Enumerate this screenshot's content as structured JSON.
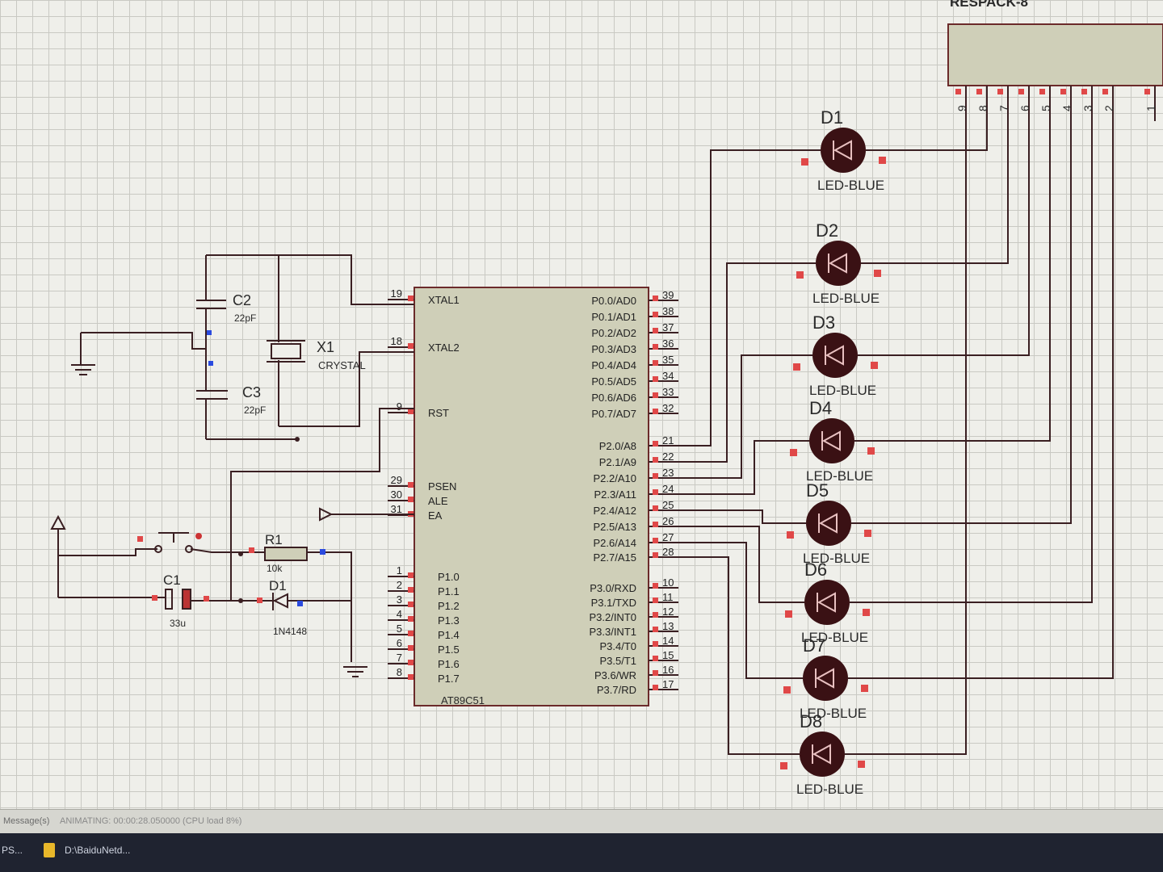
{
  "chip": {
    "name": "AT89C51",
    "left_pins": [
      {
        "num": "19",
        "name": "XTAL1"
      },
      {
        "num": "18",
        "name": "XTAL2"
      },
      {
        "num": "9",
        "name": "RST"
      },
      {
        "num": "29",
        "name": "PSEN"
      },
      {
        "num": "30",
        "name": "ALE"
      },
      {
        "num": "31",
        "name": "EA"
      },
      {
        "num": "1",
        "name": "P1.0"
      },
      {
        "num": "2",
        "name": "P1.1"
      },
      {
        "num": "3",
        "name": "P1.2"
      },
      {
        "num": "4",
        "name": "P1.3"
      },
      {
        "num": "5",
        "name": "P1.4"
      },
      {
        "num": "6",
        "name": "P1.5"
      },
      {
        "num": "7",
        "name": "P1.6"
      },
      {
        "num": "8",
        "name": "P1.7"
      }
    ],
    "right_pins": [
      {
        "num": "39",
        "name": "P0.0/AD0"
      },
      {
        "num": "38",
        "name": "P0.1/AD1"
      },
      {
        "num": "37",
        "name": "P0.2/AD2"
      },
      {
        "num": "36",
        "name": "P0.3/AD3"
      },
      {
        "num": "35",
        "name": "P0.4/AD4"
      },
      {
        "num": "34",
        "name": "P0.5/AD5"
      },
      {
        "num": "33",
        "name": "P0.6/AD6"
      },
      {
        "num": "32",
        "name": "P0.7/AD7"
      },
      {
        "num": "21",
        "name": "P2.0/A8"
      },
      {
        "num": "22",
        "name": "P2.1/A9"
      },
      {
        "num": "23",
        "name": "P2.2/A10"
      },
      {
        "num": "24",
        "name": "P2.3/A11"
      },
      {
        "num": "25",
        "name": "P2.4/A12"
      },
      {
        "num": "26",
        "name": "P2.5/A13"
      },
      {
        "num": "27",
        "name": "P2.6/A14"
      },
      {
        "num": "28",
        "name": "P2.7/A15"
      },
      {
        "num": "10",
        "name": "P3.0/RXD"
      },
      {
        "num": "11",
        "name": "P3.1/TXD"
      },
      {
        "num": "12",
        "name": "P3.2/INT0"
      },
      {
        "num": "13",
        "name": "P3.3/INT1"
      },
      {
        "num": "14",
        "name": "P3.4/T0"
      },
      {
        "num": "15",
        "name": "P3.5/T1"
      },
      {
        "num": "16",
        "name": "P3.6/WR"
      },
      {
        "num": "17",
        "name": "P3.7/RD"
      }
    ]
  },
  "components": {
    "c2": {
      "ref": "C2",
      "value": "22pF"
    },
    "c3": {
      "ref": "C3",
      "value": "22pF"
    },
    "x1": {
      "ref": "X1",
      "value": "CRYSTAL"
    },
    "r1": {
      "ref": "R1",
      "value": "10k"
    },
    "c1": {
      "ref": "C1",
      "value": "33u"
    },
    "d1": {
      "ref": "D1",
      "value": "1N4148"
    }
  },
  "leds": [
    {
      "ref": "D1",
      "type": "LED-BLUE"
    },
    {
      "ref": "D2",
      "type": "LED-BLUE"
    },
    {
      "ref": "D3",
      "type": "LED-BLUE"
    },
    {
      "ref": "D4",
      "type": "LED-BLUE"
    },
    {
      "ref": "D5",
      "type": "LED-BLUE"
    },
    {
      "ref": "D6",
      "type": "LED-BLUE"
    },
    {
      "ref": "D7",
      "type": "LED-BLUE"
    },
    {
      "ref": "D8",
      "type": "LED-BLUE"
    }
  ],
  "respack": {
    "label": "RESPACK-8",
    "pins": [
      "9",
      "8",
      "7",
      "6",
      "5",
      "4",
      "3",
      "2",
      "1"
    ]
  },
  "status": {
    "left": "Message(s)",
    "text": "ANIMATING: 00:00:28.050000 (CPU load 8%)"
  },
  "taskbar": {
    "item1": "PS...",
    "item2": "D:\\BaiduNetd..."
  }
}
